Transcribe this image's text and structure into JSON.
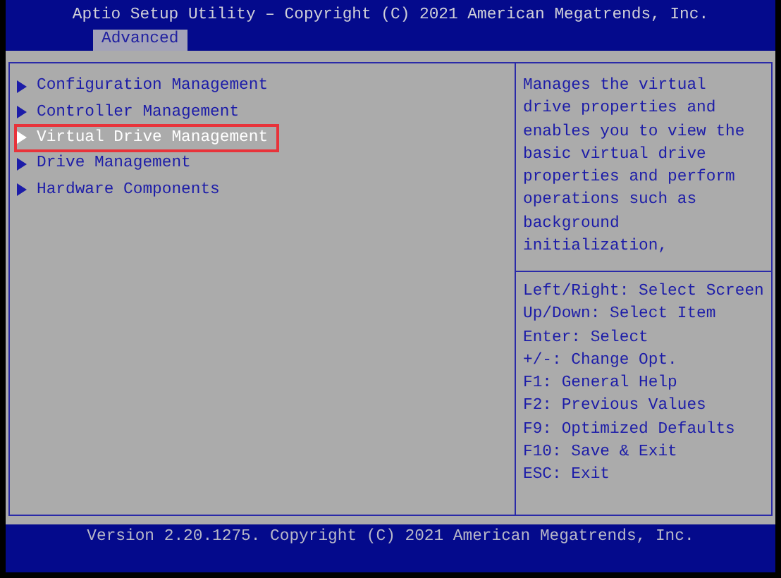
{
  "window": {
    "title": "Aptio Setup Utility – Copyright (C) 2021 American Megatrends, Inc."
  },
  "tabs": [
    {
      "label": "Advanced",
      "selected": true
    }
  ],
  "menu": {
    "items": [
      {
        "label": "Configuration Management",
        "selected": false
      },
      {
        "label": "Controller Management",
        "selected": false
      },
      {
        "label": "Virtual Drive Management",
        "selected": true
      },
      {
        "label": "Drive Management",
        "selected": false
      },
      {
        "label": "Hardware Components",
        "selected": false
      }
    ]
  },
  "help": {
    "description": "Manages the virtual drive properties and enables you to view the basic virtual drive properties and perform operations such as background initialization,",
    "keys": [
      "Left/Right: Select Screen",
      "Up/Down: Select Item",
      "Enter: Select",
      "+/-: Change Opt.",
      "F1: General Help",
      "F2: Previous Values",
      "F9: Optimized Defaults",
      "F10: Save & Exit",
      "ESC: Exit"
    ]
  },
  "status_bar": {
    "text": "Version 2.20.1275. Copyright (C) 2021 American Megatrends, Inc."
  }
}
